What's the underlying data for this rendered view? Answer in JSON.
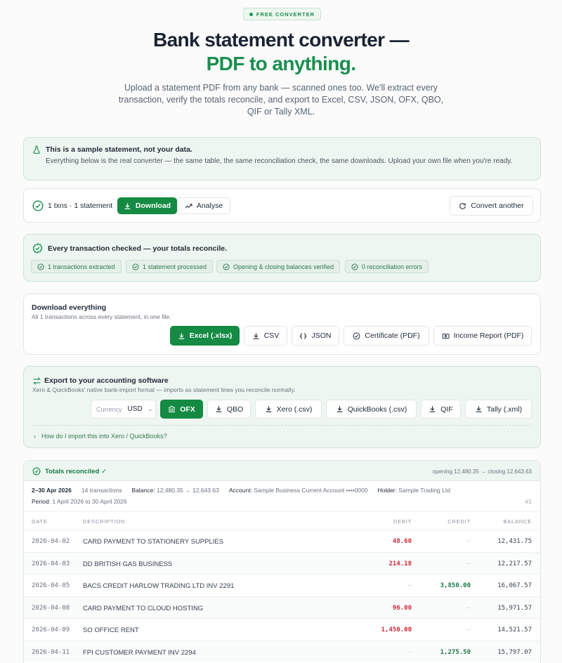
{
  "badge": "FREE CONVERTER",
  "hero": {
    "title_main": "Bank statement converter — ",
    "title_accent": "PDF to anything.",
    "subtitle": "Upload a statement PDF from any bank — scanned ones too. We'll extract every transaction, verify the totals reconcile, and export to Excel, CSV, JSON, OFX, QBO, QIF or Tally XML."
  },
  "notice": {
    "title": "This is a sample statement, not your data.",
    "body": "Everything below is the real converter — the same table, the same reconciliation check, the same downloads. Upload your own file when you're ready."
  },
  "toolbar": {
    "summary": "1 txns · 1 statement",
    "download": "Download",
    "analyse": "Analyse",
    "convert_another": "Convert another"
  },
  "reconcile": {
    "title": "Every transaction checked — your totals reconcile.",
    "chips": [
      "1 transactions extracted",
      "1 statement processed",
      "Opening & closing balances verified",
      "0 reconciliation errors"
    ]
  },
  "download_all": {
    "title": "Download everything",
    "subtitle": "All 1 transactions across every statement, in one file.",
    "buttons": [
      "Excel (.xlsx)",
      "CSV",
      "JSON",
      "Certificate (PDF)",
      "Income Report (PDF)"
    ]
  },
  "export": {
    "title": "Export to your accounting software",
    "subtitle": "Xero & QuickBooks' native bank-import format — imports as statement lines you reconcile normally.",
    "currency_label": "Currency",
    "currency_value": "USD",
    "buttons": [
      "OFX",
      "QBO",
      "Xero (.csv)",
      "QuickBooks (.csv)",
      "QIF",
      "Tally (.xml)"
    ],
    "howto": "How do I import this into Xero / QuickBooks?"
  },
  "statement": {
    "status": "Totals reconciled ✓",
    "opening_closing": "opening 12,480.35 → closing 12,643.63",
    "range": "2–30 Apr 2026",
    "tx_count": "14 transactions",
    "balance_label": "Balance:",
    "balance_value": "12,480.35 → 12,643.63",
    "account_label": "Account:",
    "account_value": "Sample Business Current Account ••••0000",
    "holder_label": "Holder:",
    "holder_value": "Sample Trading Ltd",
    "period_label": "Period:",
    "period_value": "1 April 2026 to 30 April 2026",
    "page_no": "#1",
    "columns": [
      "DATE",
      "DESCRIPTION",
      "DEBIT",
      "CREDIT",
      "BALANCE"
    ],
    "rows": [
      {
        "date": "2026-04-02",
        "desc": "CARD PAYMENT TO STATIONERY SUPPLIES",
        "debit": "48.60",
        "credit": "–",
        "balance": "12,431.75"
      },
      {
        "date": "2026-04-03",
        "desc": "DD BRITISH GAS BUSINESS",
        "debit": "214.18",
        "credit": "–",
        "balance": "12,217.57"
      },
      {
        "date": "2026-04-05",
        "desc": "BACS CREDIT HARLOW TRADING LTD INV 2291",
        "debit": "–",
        "credit": "3,850.00",
        "balance": "16,067.57"
      },
      {
        "date": "2026-04-08",
        "desc": "CARD PAYMENT TO CLOUD HOSTING",
        "debit": "96.00",
        "credit": "–",
        "balance": "15,971.57"
      },
      {
        "date": "2026-04-09",
        "desc": "SO OFFICE RENT",
        "debit": "1,450.00",
        "credit": "–",
        "balance": "14,521.57"
      },
      {
        "date": "2026-04-11",
        "desc": "FPI CUSTOMER PAYMENT INV 2294",
        "debit": "–",
        "credit": "1,275.50",
        "balance": "15,797.07"
      }
    ]
  },
  "colors": {
    "accent": "#1a8f4f",
    "primary_button": "#148a43",
    "debit": "#d12a3a",
    "credit": "#1a7a44"
  }
}
